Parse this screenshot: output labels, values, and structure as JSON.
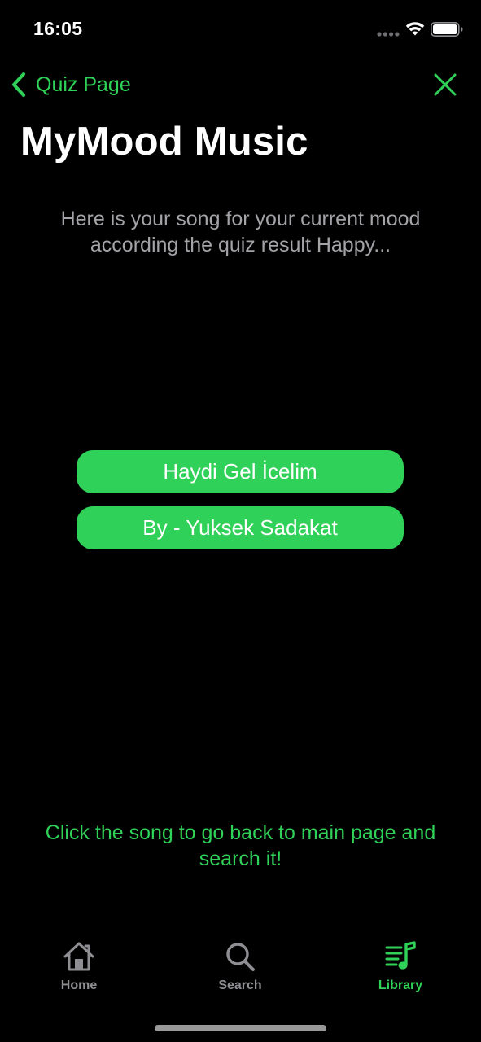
{
  "status_bar": {
    "time": "16:05"
  },
  "nav": {
    "back_label": "Quiz Page",
    "back_icon": "chevron-left-icon",
    "close_icon": "close-icon"
  },
  "page": {
    "title": "MyMood Music",
    "intro": "Here is your song for your current mood according the quiz result Happy...",
    "song_title": "Haydi Gel İcelim",
    "song_artist": "By - Yuksek Sadakat",
    "hint": "Click the song to go back to main page and search it!"
  },
  "tab_bar": {
    "tabs": [
      {
        "label": "Home",
        "icon": "house-icon",
        "selected": false
      },
      {
        "label": "Search",
        "icon": "magnifying-glass-icon",
        "selected": false
      },
      {
        "label": "Library",
        "icon": "music-list-icon",
        "selected": true
      }
    ]
  },
  "colors": {
    "accent": "#30d158",
    "background": "#000000",
    "secondary_text": "#a3a3a8",
    "inactive_tab": "#8e8e93"
  }
}
